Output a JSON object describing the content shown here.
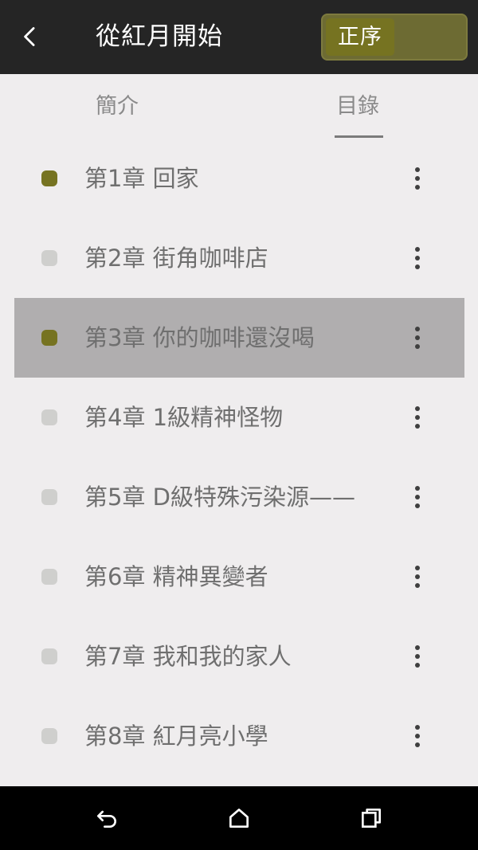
{
  "header": {
    "back_icon": "chevron-left-icon",
    "title": "從紅月開始",
    "sort_label": "正序"
  },
  "tabs": [
    {
      "label": "簡介",
      "active": false
    },
    {
      "label": "目錄",
      "active": true
    }
  ],
  "chapters": [
    {
      "title": "第1章 回家",
      "read": true,
      "selected": false
    },
    {
      "title": "第2章 街角咖啡店",
      "read": false,
      "selected": false
    },
    {
      "title": "第3章 你的咖啡還沒喝",
      "read": true,
      "selected": true
    },
    {
      "title": "第4章 1級精神怪物",
      "read": false,
      "selected": false
    },
    {
      "title": "第5章 D級特殊污染源——",
      "read": false,
      "selected": false
    },
    {
      "title": "第6章 精神異變者",
      "read": false,
      "selected": false
    },
    {
      "title": "第7章 我和我的家人",
      "read": false,
      "selected": false
    },
    {
      "title": "第8章 紅月亮小學",
      "read": false,
      "selected": false
    }
  ],
  "system_nav": {
    "back_icon": "android-back-icon",
    "home_icon": "home-icon",
    "recent_icon": "recent-apps-icon"
  },
  "colors": {
    "topbar": "#252525",
    "accent": "#767321",
    "selected_row": "#b0aeaf",
    "background": "#efedee",
    "unread_dot": "#cfcfcd"
  }
}
